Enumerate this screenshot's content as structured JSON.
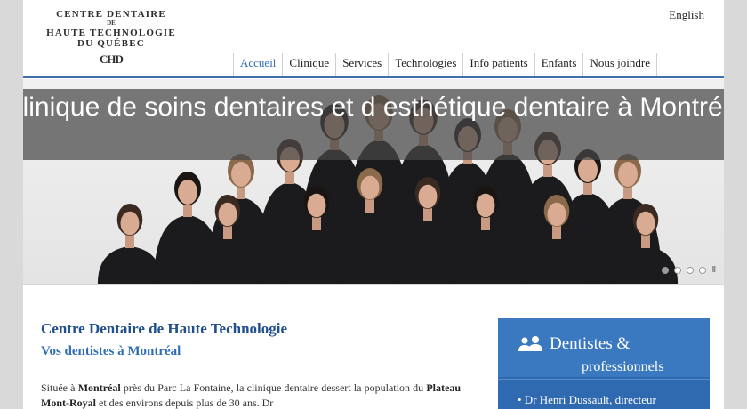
{
  "logo": {
    "line1": "CENTRE DENTAIRE",
    "line2": "DE",
    "line3": "HAUTE TECHNOLOGIE",
    "line4": "DU QUÉBEC",
    "mark": "CHD"
  },
  "header": {
    "language_link": "English"
  },
  "nav": {
    "items": [
      "Accueil",
      "Clinique",
      "Services",
      "Technologies",
      "Info patients",
      "Enfants",
      "Nous joindre"
    ],
    "active": "Accueil"
  },
  "hero": {
    "caption": "Clinique de soins dentaires et d esthétique dentaire à Montréal",
    "slide_count": 4,
    "active_slide": 1,
    "pause_label": "II"
  },
  "main": {
    "title": "Centre Dentaire de Haute Technologie",
    "subtitle": "Vos dentistes à Montréal",
    "para_1": "Située à",
    "para_2": "Montréal",
    "para_3": "près du Parc La Fontaine, la clinique dentaire dessert la population du",
    "para_4": "Plateau Mont-Royal",
    "para_5": "et des environs depuis plus de 30 ans. Dr"
  },
  "sidebar": {
    "icon": "users-icon",
    "title_1": "Dentistes &",
    "title_2": "professionnels",
    "first_item": "• Dr Henri Dussault, directeur"
  },
  "colors": {
    "accent": "#2f6db5",
    "nav_rule": "#3d6fab",
    "sidebar_bg": "#2f6ab0",
    "caption_overlay": "#464646"
  }
}
